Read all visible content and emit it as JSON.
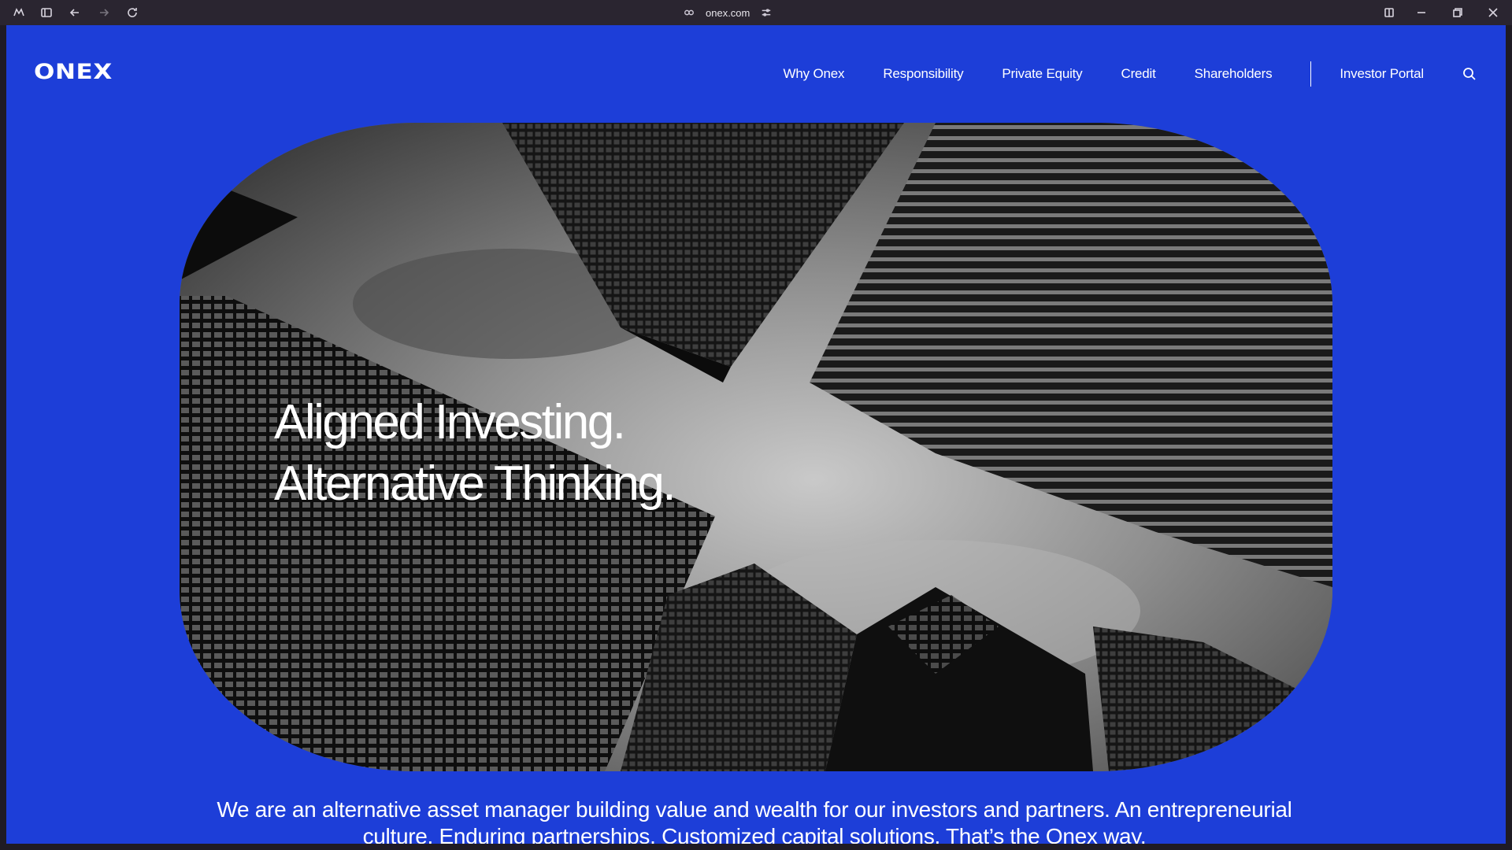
{
  "browser": {
    "url": "onex.com"
  },
  "site": {
    "logo": "ONEX",
    "nav": [
      {
        "label": "Why Onex"
      },
      {
        "label": "Responsibility"
      },
      {
        "label": "Private Equity"
      },
      {
        "label": "Credit"
      },
      {
        "label": "Shareholders"
      }
    ],
    "portal_label": "Investor Portal"
  },
  "hero": {
    "line1": "Aligned Investing.",
    "line2": "Alternative Thinking."
  },
  "intro": {
    "text": "We are an alternative asset manager building value and wealth for our investors and partners. An entrepreneurial culture. Enduring partnerships. Customized capital solutions. That’s the Onex way."
  },
  "colors": {
    "brand_blue": "#1d3ed8",
    "browser_bar": "#2a2530"
  }
}
